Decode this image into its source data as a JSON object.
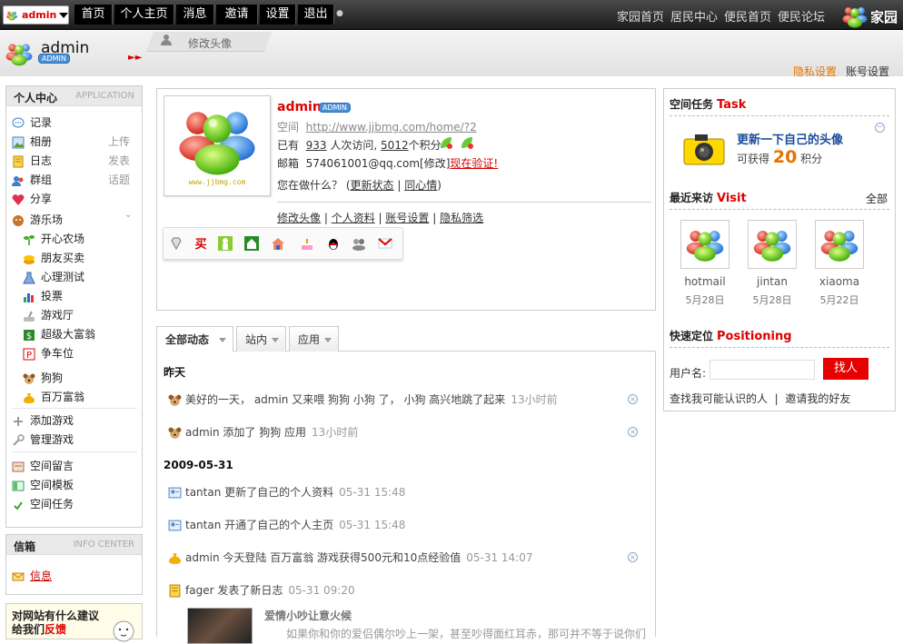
{
  "topbar": {
    "user": "admin",
    "nav": [
      "首页",
      "个人主页",
      "消息",
      "邀请",
      "设置",
      "退出"
    ],
    "right_nav": [
      "家园首页",
      "居民中心",
      "便民首页",
      "便民论坛"
    ],
    "brand": "家园"
  },
  "header": {
    "username": "admin",
    "badge": "ADMIN",
    "tab": "修改头像",
    "privacy": "隐私设置",
    "account": "账号设置"
  },
  "sidebar": {
    "title": "个人中心",
    "title_en": "APPLICATION",
    "items": [
      {
        "label": "记录",
        "icon": "speech-bubble-icon",
        "right": ""
      },
      {
        "label": "相册",
        "icon": "photo-icon",
        "right": "上传"
      },
      {
        "label": "日志",
        "icon": "notebook-icon",
        "right": "发表"
      },
      {
        "label": "群组",
        "icon": "group-icon",
        "right": "话题"
      },
      {
        "label": "分享",
        "icon": "heart-icon",
        "right": ""
      },
      {
        "label": "游乐场",
        "icon": "playground-icon",
        "right": ""
      }
    ],
    "games": [
      {
        "label": "开心农场",
        "icon": "sprout-icon"
      },
      {
        "label": "朋友买卖",
        "icon": "coins-icon"
      },
      {
        "label": "心理测试",
        "icon": "flask-icon"
      },
      {
        "label": "投票",
        "icon": "bar-chart-icon"
      },
      {
        "label": "游戏厅",
        "icon": "joystick-icon"
      },
      {
        "label": "超级大富翁",
        "icon": "dollar-icon"
      },
      {
        "label": "争车位",
        "icon": "parking-icon"
      }
    ],
    "games2": [
      {
        "label": "狗狗",
        "icon": "dog-icon"
      },
      {
        "label": "百万富翁",
        "icon": "money-bag-icon"
      }
    ],
    "manage": [
      {
        "label": "添加游戏",
        "icon": "plus-icon"
      },
      {
        "label": "管理游戏",
        "icon": "wrench-icon"
      }
    ],
    "space": [
      {
        "label": "空间留言",
        "icon": "guestbook-icon"
      },
      {
        "label": "空间模板",
        "icon": "template-icon"
      },
      {
        "label": "空间任务",
        "icon": "task-icon"
      }
    ]
  },
  "info": {
    "title": "信箱",
    "title_en": "INFO CENTER",
    "item": "信息"
  },
  "suggest": {
    "line1": "对网站有什么建议",
    "line2_prefix": "给我们",
    "line2_red": "反馈"
  },
  "profile": {
    "name": "admin",
    "badge": "ADMIN",
    "site_label": "空间",
    "site_url": "http://www.jjbmg.com/home/?2",
    "visits_prefix": "已有",
    "visits": "933",
    "visits_mid": "人次访问,",
    "points": "5012",
    "points_suffix": "个积分",
    "email_label": "邮箱",
    "email": "574061001@qq.com",
    "email_edit": "[修改]",
    "email_verify": "现在验证!",
    "status_prompt": "您在做什么？",
    "status_update": "更新状态",
    "status_mood": "同心情",
    "avatar_caption": "www.jjbmg.com",
    "links": [
      "修改头像",
      "个人资料",
      "账号设置",
      "隐私筛选"
    ],
    "icons": [
      "diamond-icon",
      "buy-icon",
      "person-icon",
      "house-icon",
      "home-icon",
      "cake-icon",
      "qq-icon",
      "friends-icon",
      "gmail-icon"
    ]
  },
  "feed": {
    "tabs": [
      "全部动态",
      "站内",
      "应用"
    ],
    "groups": [
      {
        "date": "昨天",
        "items": [
          {
            "icon": "dog-icon",
            "text": "美好的一天， admin 又来喂  狗狗  小狗  了，  小狗  高兴地跳了起来",
            "time": "13小时前",
            "close": true
          },
          {
            "icon": "dog-icon",
            "text": "admin 添加了 狗狗 应用",
            "time": "13小时前",
            "close": true
          }
        ]
      },
      {
        "date": "2009-05-31",
        "items": [
          {
            "icon": "profile-card-icon",
            "text": "tantan 更新了自己的个人资料",
            "time": "05-31 15:48",
            "close": false
          },
          {
            "icon": "profile-card-icon",
            "text": "tantan 开通了自己的个人主页",
            "time": "05-31 15:48",
            "close": false
          },
          {
            "icon": "money-bag-icon",
            "text": "admin 今天登陆  百万富翁  游戏获得500元和10点经验值",
            "time": "05-31 14:07",
            "close": true
          },
          {
            "icon": "notebook-icon",
            "text": "fager 发表了新日志",
            "time": "05-31 09:20",
            "close": false
          }
        ]
      }
    ],
    "blog_title": "爱情小吵让意火候",
    "blog_excerpt": "如果你和你的爱侣偶尔吵上一架，甚至吵得面红耳赤，那可并不等于说你们"
  },
  "right": {
    "task_title": "空间任务",
    "task_en": "Task",
    "task_text": "更新一下自己的头像",
    "task_reward_prefix": "可获得",
    "task_reward": "20",
    "task_reward_suffix": "积分",
    "visit_title": "最近来访",
    "visit_en": "Visit",
    "visit_all": "全部",
    "visitors": [
      {
        "name": "hotmail",
        "date": "5月28日"
      },
      {
        "name": "jintan",
        "date": "5月28日"
      },
      {
        "name": "xiaoma",
        "date": "5月22日"
      }
    ],
    "pos_title": "快速定位",
    "pos_en": "Positioning",
    "user_label": "用户名:",
    "find_button": "找人",
    "find_link1": "查找我可能认识的人",
    "find_link2": "邀请我的好友"
  },
  "colors": {
    "accent_red": "#d00000",
    "link_blue": "#1a4a9a",
    "orange": "#e67300"
  }
}
